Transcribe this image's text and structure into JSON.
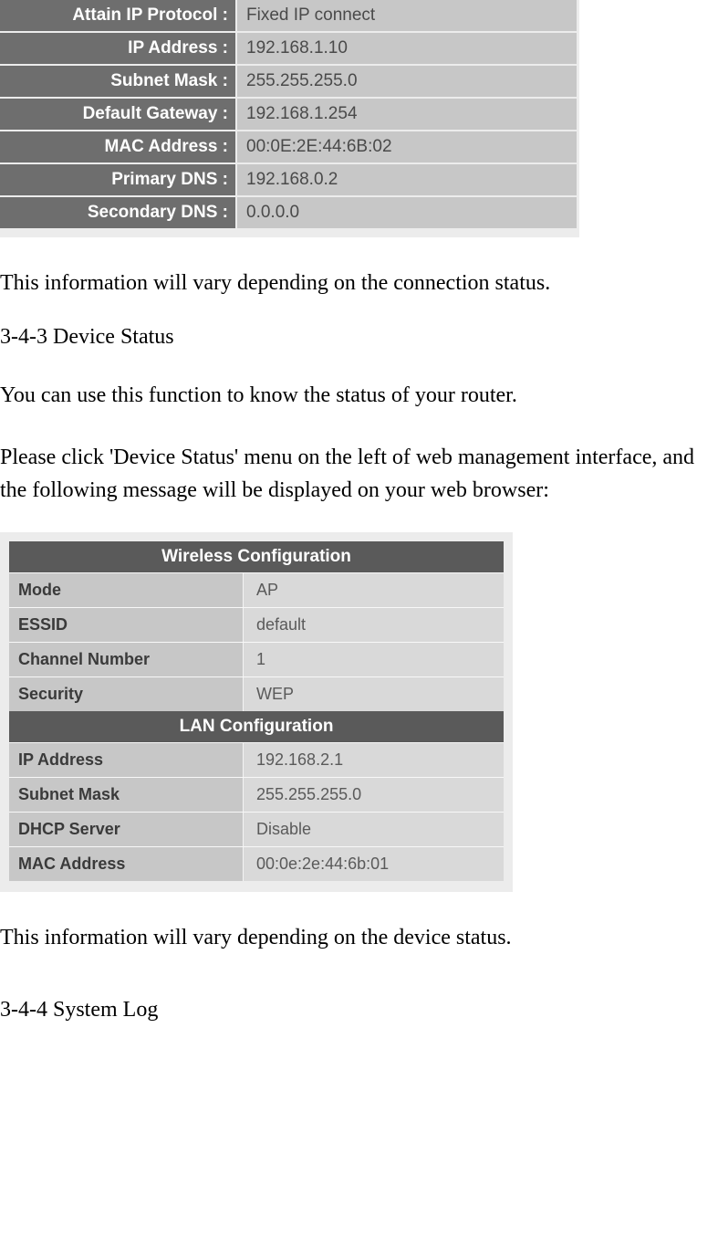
{
  "network": {
    "rows": [
      {
        "label": "Attain IP Protocol :",
        "value": "Fixed IP connect"
      },
      {
        "label": "IP Address :",
        "value": "192.168.1.10"
      },
      {
        "label": "Subnet Mask :",
        "value": "255.255.255.0"
      },
      {
        "label": "Default Gateway :",
        "value": "192.168.1.254"
      },
      {
        "label": "MAC Address :",
        "value": "00:0E:2E:44:6B:02"
      },
      {
        "label": "Primary DNS :",
        "value": "192.168.0.2"
      },
      {
        "label": "Secondary DNS :",
        "value": "0.0.0.0"
      }
    ]
  },
  "text": {
    "p1": "This information will vary depending on the connection status.",
    "h1": "3-4-3 Device Status",
    "p2": "You can use this function to know the status of your router.",
    "p3": "Please click 'Device Status' menu on the left of web management interface, and the following message will be displayed on your web browser:",
    "p4": "This information will vary depending on the device status.",
    "h2": "3-4-4 System Log"
  },
  "config": {
    "wireless_header": "Wireless Configuration",
    "wireless_rows": [
      {
        "label": "Mode",
        "value": "AP"
      },
      {
        "label": "ESSID",
        "value": "default"
      },
      {
        "label": "Channel Number",
        "value": "1"
      },
      {
        "label": "Security",
        "value": "WEP"
      }
    ],
    "lan_header": "LAN Configuration",
    "lan_rows": [
      {
        "label": "IP Address",
        "value": "192.168.2.1"
      },
      {
        "label": "Subnet Mask",
        "value": "255.255.255.0"
      },
      {
        "label": "DHCP Server",
        "value": "Disable"
      },
      {
        "label": "MAC Address",
        "value": "00:0e:2e:44:6b:01"
      }
    ]
  }
}
